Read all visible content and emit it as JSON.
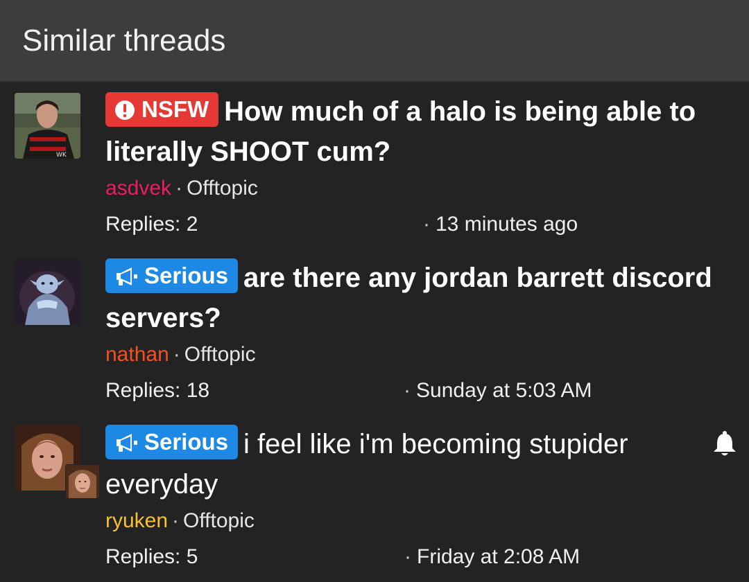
{
  "header": {
    "title": "Similar threads"
  },
  "threads": [
    {
      "label": "NSFW",
      "label_color": "#e53935",
      "title": "How much of a halo is being able to literally SHOOT cum?",
      "author": "asdvek",
      "author_color": "#e91e63",
      "forum": "Offtopic",
      "replies": "Replies: 2",
      "date": "13 minutes ago"
    },
    {
      "label": "Serious",
      "label_color": "#1e88e5",
      "title": "are there any jordan barrett discord servers?",
      "author": "nathan",
      "author_color": "#f4511e",
      "forum": "Offtopic",
      "replies": "Replies: 18",
      "date": "Sunday at 5:03 AM"
    },
    {
      "label": "Serious",
      "label_color": "#1e88e5",
      "title": "i feel like i'm becoming stupider everyday",
      "author": "ryuken",
      "author_color": "#fbc02d",
      "forum": "Offtopic",
      "replies": "Replies: 5",
      "date": "Friday at 2:08 AM",
      "watched_icon": "bell-icon"
    }
  ]
}
